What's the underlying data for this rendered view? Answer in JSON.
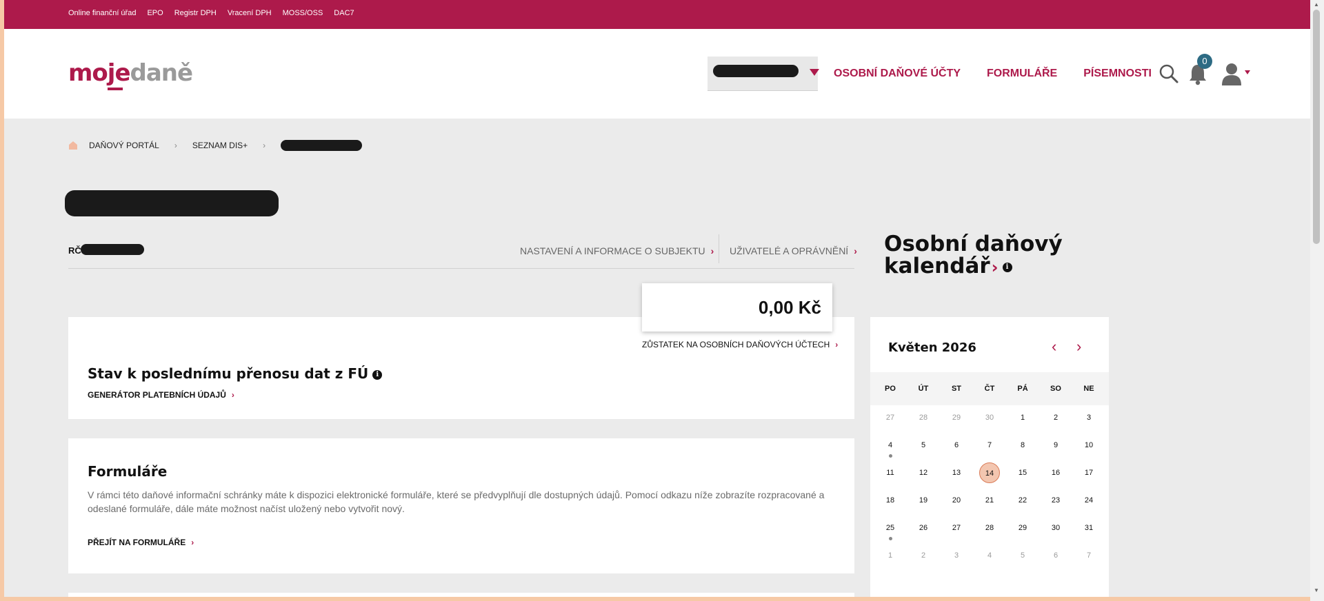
{
  "topbar": {
    "links": [
      "Online finanční úřad",
      "EPO",
      "Registr DPH",
      "Vracení DPH",
      "MOSS/OSS",
      "DAC7"
    ]
  },
  "header": {
    "logo_part1": "moje",
    "logo_part2": "daně",
    "nav": [
      "OSOBNÍ DAŇOVÉ ÚČTY",
      "FORMULÁŘE",
      "PÍSEMNOSTI"
    ],
    "notifications_count": "0"
  },
  "breadcrumb": {
    "items": [
      "DAŇOVÝ PORTÁL",
      "SEZNAM DIS+"
    ],
    "separator": "›"
  },
  "subject": {
    "rc_label": "RČ",
    "settings_link": "NASTAVENÍ A INFORMACE O SUBJEKTU",
    "users_link": "UŽIVATELÉ A OPRÁVNĚNÍ"
  },
  "balance": {
    "amount": "0,00 Kč",
    "link": "ZŮSTATEK NA OSOBNÍCH DAŇOVÝCH ÚČTECH"
  },
  "status_card": {
    "title": "Stav k poslednímu přenosu dat z FÚ",
    "link": "GENERÁTOR PLATEBNÍCH ÚDAJŮ"
  },
  "forms_card": {
    "title": "Formuláře",
    "text": "V rámci této daňové informační schránky máte k dispozici elektronické formuláře, které se předvyplňují dle dostupných údajů. Pomocí odkazu níže zobrazíte rozpracované a odeslané formuláře, dále máte možnost načíst uložený nebo vytvořit nový.",
    "link": "PŘEJÍT NA FORMULÁŘE"
  },
  "calendar": {
    "heading_line1": "Osobní daňový",
    "heading_line2": "kalendář",
    "month": "Květen 2026",
    "weekdays": [
      "PO",
      "ÚT",
      "ST",
      "ČT",
      "PÁ",
      "SO",
      "NE"
    ],
    "weeks": [
      [
        "27",
        "28",
        "29",
        "30",
        "1",
        "2",
        "3"
      ],
      [
        "4",
        "5",
        "6",
        "7",
        "8",
        "9",
        "10"
      ],
      [
        "11",
        "12",
        "13",
        "14",
        "15",
        "16",
        "17"
      ],
      [
        "18",
        "19",
        "20",
        "21",
        "22",
        "23",
        "24"
      ],
      [
        "25",
        "26",
        "27",
        "28",
        "29",
        "30",
        "31"
      ],
      [
        "1",
        "2",
        "3",
        "4",
        "5",
        "6",
        "7"
      ]
    ],
    "today": "14",
    "event_days": [
      "4",
      "25"
    ]
  },
  "icons": {
    "chevron": "chevron-right-icon",
    "info": "i"
  },
  "colors": {
    "brand": "#ad1a4b",
    "badge": "#2d6b84",
    "today": "#f3c6b0"
  }
}
